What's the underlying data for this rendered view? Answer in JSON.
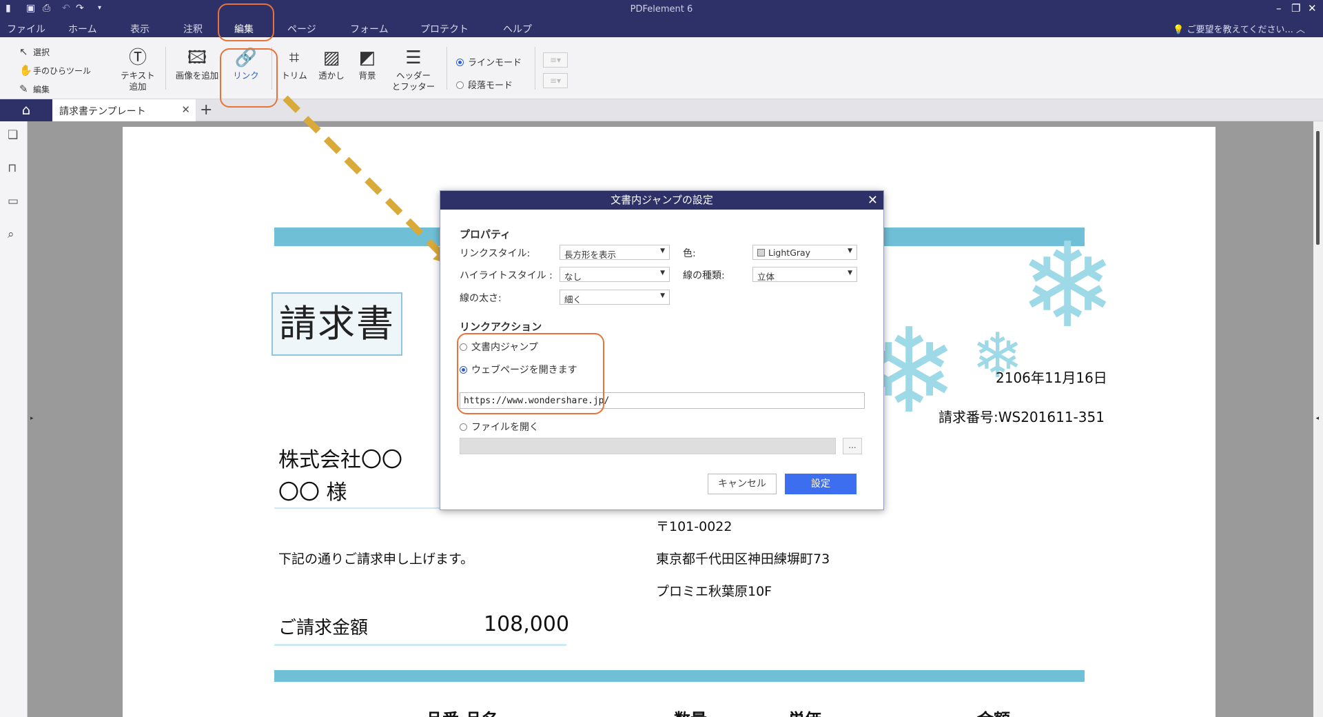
{
  "app": {
    "title": "PDFelement 6",
    "help_hint": "ご要望を教えてください..."
  },
  "menu": [
    "ファイル",
    "ホーム",
    "表示",
    "注釈",
    "編集",
    "ページ",
    "フォーム",
    "プロテクト",
    "ヘルプ"
  ],
  "menu_active": "編集",
  "ribbon": {
    "select": "選択",
    "hand": "手のひらツール",
    "edit": "編集",
    "add_text": "テキスト\n追加",
    "add_text_1": "テキスト",
    "add_text_2": "追加",
    "add_image": "画像を追加",
    "link": "リンク",
    "trim": "トリム",
    "watermark": "透かし",
    "background": "背景",
    "header_footer_1": "ヘッダー",
    "header_footer_2": "とフッター",
    "line_mode": "ラインモード",
    "paragraph_mode": "段落モード"
  },
  "tabs": {
    "doc_tab": "請求書テンプレート"
  },
  "document": {
    "title": "請求書",
    "date": "2106年11月16日",
    "invoice_no": "請求番号:WS201611-351",
    "company": "株式会社〇〇",
    "customer": "〇〇 様",
    "postal": "〒101-0022",
    "address": "東京都千代田区神田練塀町73",
    "building": "プロミエ秋葉原10F",
    "message": "下記の通りご請求申し上げます。",
    "amount_label": "ご請求金額",
    "amount_value": "108,000",
    "col_item": "品番·品名",
    "col_qty": "数量",
    "col_price": "単価",
    "col_total": "金額"
  },
  "dialog": {
    "title": "文書内ジャンプの設定",
    "properties_heading": "プロパティ",
    "link_style_label": "リンクスタイル:",
    "link_style_value": "長方形を表示",
    "color_label": "色:",
    "color_value": "LightGray",
    "highlight_label": "ハイライトスタイル :",
    "highlight_value": "なし",
    "line_type_label": "線の種類:",
    "line_type_value": "立体",
    "line_width_label": "線の太さ:",
    "line_width_value": "細く",
    "action_heading": "リンクアクション",
    "opt_jump": "文書内ジャンプ",
    "opt_web": "ウェブページを開きます",
    "url": "https://www.wondershare.jp/",
    "opt_file": "ファイルを開く",
    "browse": "...",
    "cancel": "キャンセル",
    "ok": "設定",
    "selected_action": "web"
  },
  "colors": {
    "titlebar": "#2e3168",
    "accent": "#2b5cd9",
    "highlight": "#e8733a",
    "band": "#6fbfd6"
  }
}
